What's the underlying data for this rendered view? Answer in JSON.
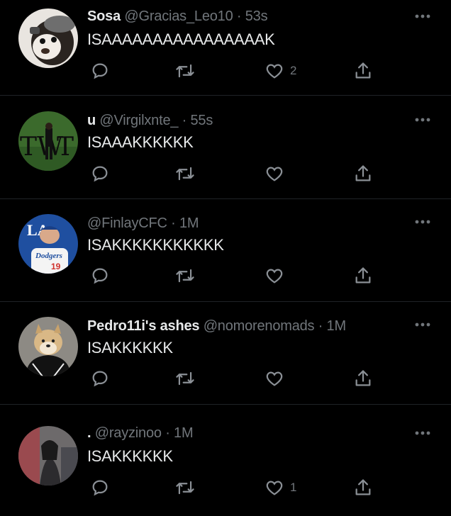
{
  "tweets": [
    {
      "display_name": "Sosa",
      "handle": "@Gracias_Leo10",
      "time": "53s",
      "text": "ISAAAAAAAAAAAAAAAAK",
      "reply_count": "",
      "retweet_count": "",
      "like_count": "2"
    },
    {
      "display_name": "u",
      "handle": "@Virgilxnte_",
      "time": "55s",
      "text": "ISAAAKKKKKK",
      "reply_count": "",
      "retweet_count": "",
      "like_count": ""
    },
    {
      "display_name": "",
      "handle": "@FinlayCFC",
      "time": "1M",
      "text": "ISAKKKKKKKKKKK",
      "reply_count": "",
      "retweet_count": "",
      "like_count": "",
      "avatar_text": {
        "cap": "LA",
        "jersey": "Dodgers",
        "number": "19"
      }
    },
    {
      "display_name": "Pedro11i's ashes",
      "handle": "@nomorenomads",
      "time": "1M",
      "text": "ISAKKKKKK",
      "reply_count": "",
      "retweet_count": "",
      "like_count": ""
    },
    {
      "display_name": ".",
      "handle": "@rayzinoo",
      "time": "1M",
      "text": "ISAKKKKKK",
      "reply_count": "",
      "retweet_count": "",
      "like_count": "1"
    }
  ],
  "colors": {
    "background": "#000000",
    "text_primary": "#e7e9ea",
    "text_secondary": "#71767b",
    "divider": "#1f2327"
  },
  "icons": {
    "reply": "reply-icon",
    "retweet": "retweet-icon",
    "like": "like-icon",
    "share": "share-icon",
    "more": "more-icon"
  }
}
